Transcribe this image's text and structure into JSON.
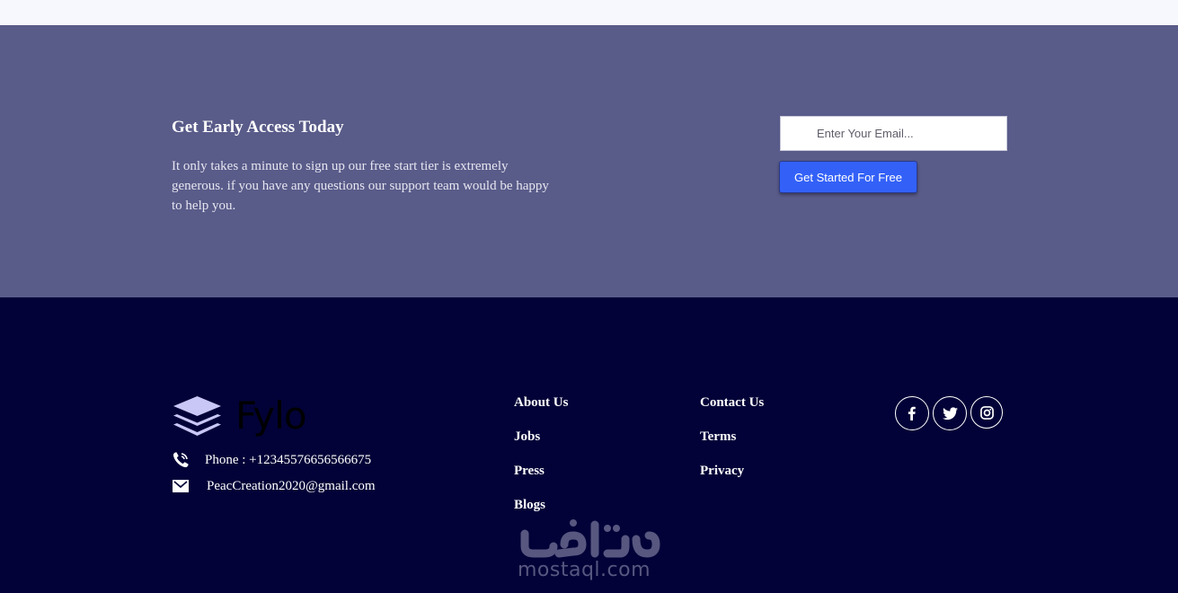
{
  "cta": {
    "title": "Get Early Access Today",
    "text": "It only takes a minute to sign up our free start tier is extremely generous. if you have any questions our support team would be happy to help you.",
    "email_placeholder": "Enter Your Email...",
    "button_label": "Get Started For Free"
  },
  "footer": {
    "logo_text": "Fylo",
    "phone": "Phone : +12345576656566675",
    "email": "PeacCreation2020@gmail.com",
    "links_col1": [
      "About Us",
      "Jobs",
      "Press",
      "Blogs"
    ],
    "links_col2": [
      "Contact Us",
      "Terms",
      "Privacy"
    ],
    "social": [
      "facebook-icon",
      "twitter-icon",
      "instagram-icon"
    ]
  },
  "watermark": {
    "latin": "mostaql.com"
  },
  "colors": {
    "cta_bg": "#595b89",
    "footer_bg": "#020238",
    "button_bg": "#3361f7",
    "logo_mark": "#c9c7f6"
  }
}
